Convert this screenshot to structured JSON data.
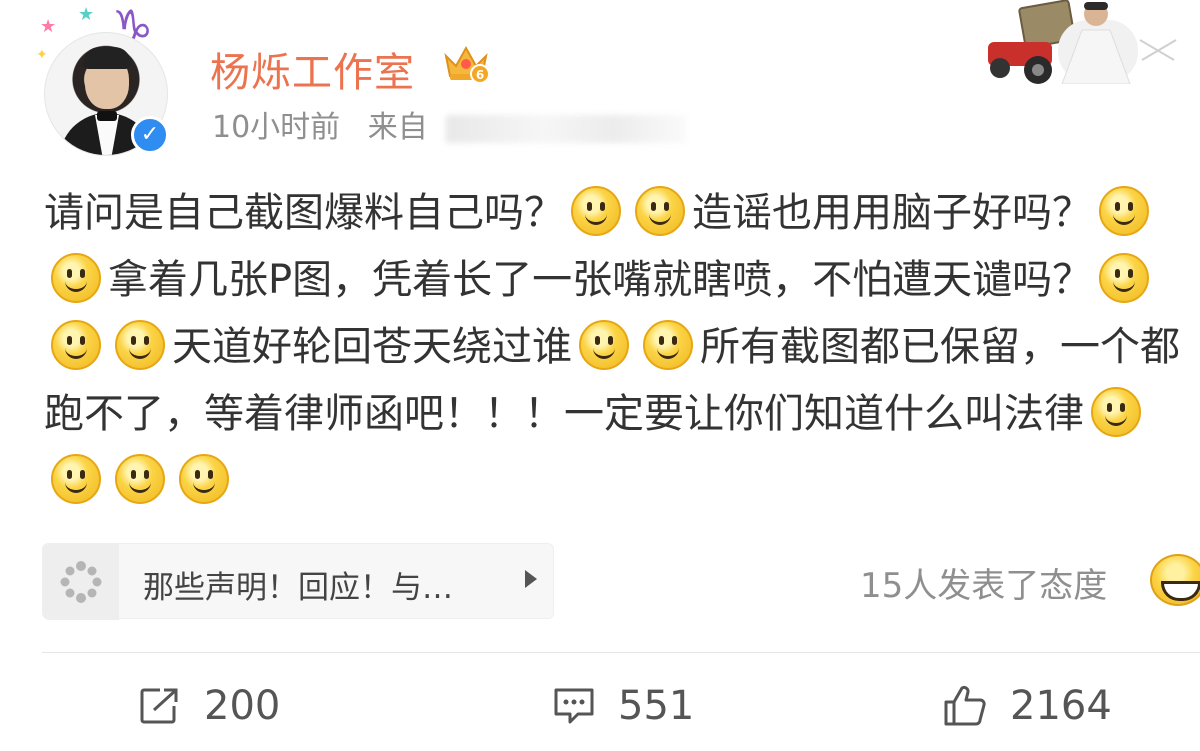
{
  "header": {
    "username": "杨烁工作室",
    "time": "10小时前",
    "source_prefix": "来自",
    "vip_level": "6"
  },
  "post": {
    "segments": [
      {
        "t": "text",
        "v": "请问是自己截图爆料自己吗？"
      },
      {
        "t": "emoji",
        "v": "smile"
      },
      {
        "t": "emoji",
        "v": "smile"
      },
      {
        "t": "text",
        "v": "造谣也用用脑子好吗？"
      },
      {
        "t": "emoji",
        "v": "smile"
      },
      {
        "t": "emoji",
        "v": "smile"
      },
      {
        "t": "text",
        "v": "拿着几张P图，凭着长了一张嘴就瞎喷，不怕遭天谴吗？"
      },
      {
        "t": "emoji",
        "v": "smile"
      },
      {
        "t": "emoji",
        "v": "smile"
      },
      {
        "t": "emoji",
        "v": "smile"
      },
      {
        "t": "text",
        "v": "天道好轮回苍天绕过谁"
      },
      {
        "t": "emoji",
        "v": "smile"
      },
      {
        "t": "emoji",
        "v": "smile"
      },
      {
        "t": "text",
        "v": "所有截图都已保留，一个都跑不了，等着律师函吧！！！一定要让你们知道什么叫法律"
      },
      {
        "t": "emoji",
        "v": "smile"
      },
      {
        "t": "emoji",
        "v": "smile"
      },
      {
        "t": "emoji",
        "v": "smile"
      },
      {
        "t": "emoji",
        "v": "smile"
      }
    ]
  },
  "repost_card": {
    "text": "那些声明！回应！与…",
    "icon": "loading-spinner-icon"
  },
  "reactions": {
    "text": "15人发表了态度",
    "icon": "grin-emoji-icon"
  },
  "actions": {
    "repost_count": "200",
    "comment_count": "551",
    "like_count": "2164"
  },
  "colors": {
    "username": "#eb7350",
    "meta": "#8f8f8f",
    "body_text": "#333333",
    "verified": "#2f8cf0",
    "zodiac": "#8a56c8"
  }
}
